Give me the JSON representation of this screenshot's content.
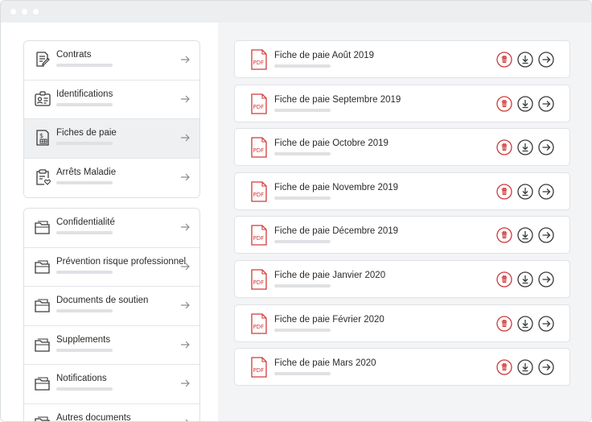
{
  "sidebar": {
    "primary": [
      {
        "label": "Contrats",
        "icon": "contract-edit-icon"
      },
      {
        "label": "Identifications",
        "icon": "id-card-icon"
      },
      {
        "label": "Fiches de paie",
        "icon": "payslip-icon",
        "active": true
      },
      {
        "label": "Arrêts Maladie",
        "icon": "clipboard-heart-icon"
      }
    ],
    "secondary": [
      {
        "label": "Confidentialité",
        "icon": "folder-icon"
      },
      {
        "label": "Prévention risque professionnel",
        "icon": "folder-icon"
      },
      {
        "label": "Documents de soutien",
        "icon": "folder-icon"
      },
      {
        "label": "Supplements",
        "icon": "folder-icon"
      },
      {
        "label": "Notifications",
        "icon": "folder-icon"
      },
      {
        "label": "Autres documents",
        "icon": "folder-icon"
      }
    ]
  },
  "files": [
    {
      "name": "Fiche de paie Août 2019"
    },
    {
      "name": "Fiche de paie Septembre 2019"
    },
    {
      "name": "Fiche de paie Octobre 2019"
    },
    {
      "name": "Fiche de paie Novembre 2019"
    },
    {
      "name": "Fiche de paie Décembre 2019"
    },
    {
      "name": "Fiche de paie Janvier 2020"
    },
    {
      "name": "Fiche de paie Février 2020"
    },
    {
      "name": "Fiche de paie Mars 2020"
    }
  ],
  "pdf_badge": "PDF",
  "colors": {
    "accent_red": "#d23a3a",
    "icon_gray": "#3a3a3a",
    "active_bg": "#eef0f2",
    "main_bg": "#f3f4f6"
  }
}
